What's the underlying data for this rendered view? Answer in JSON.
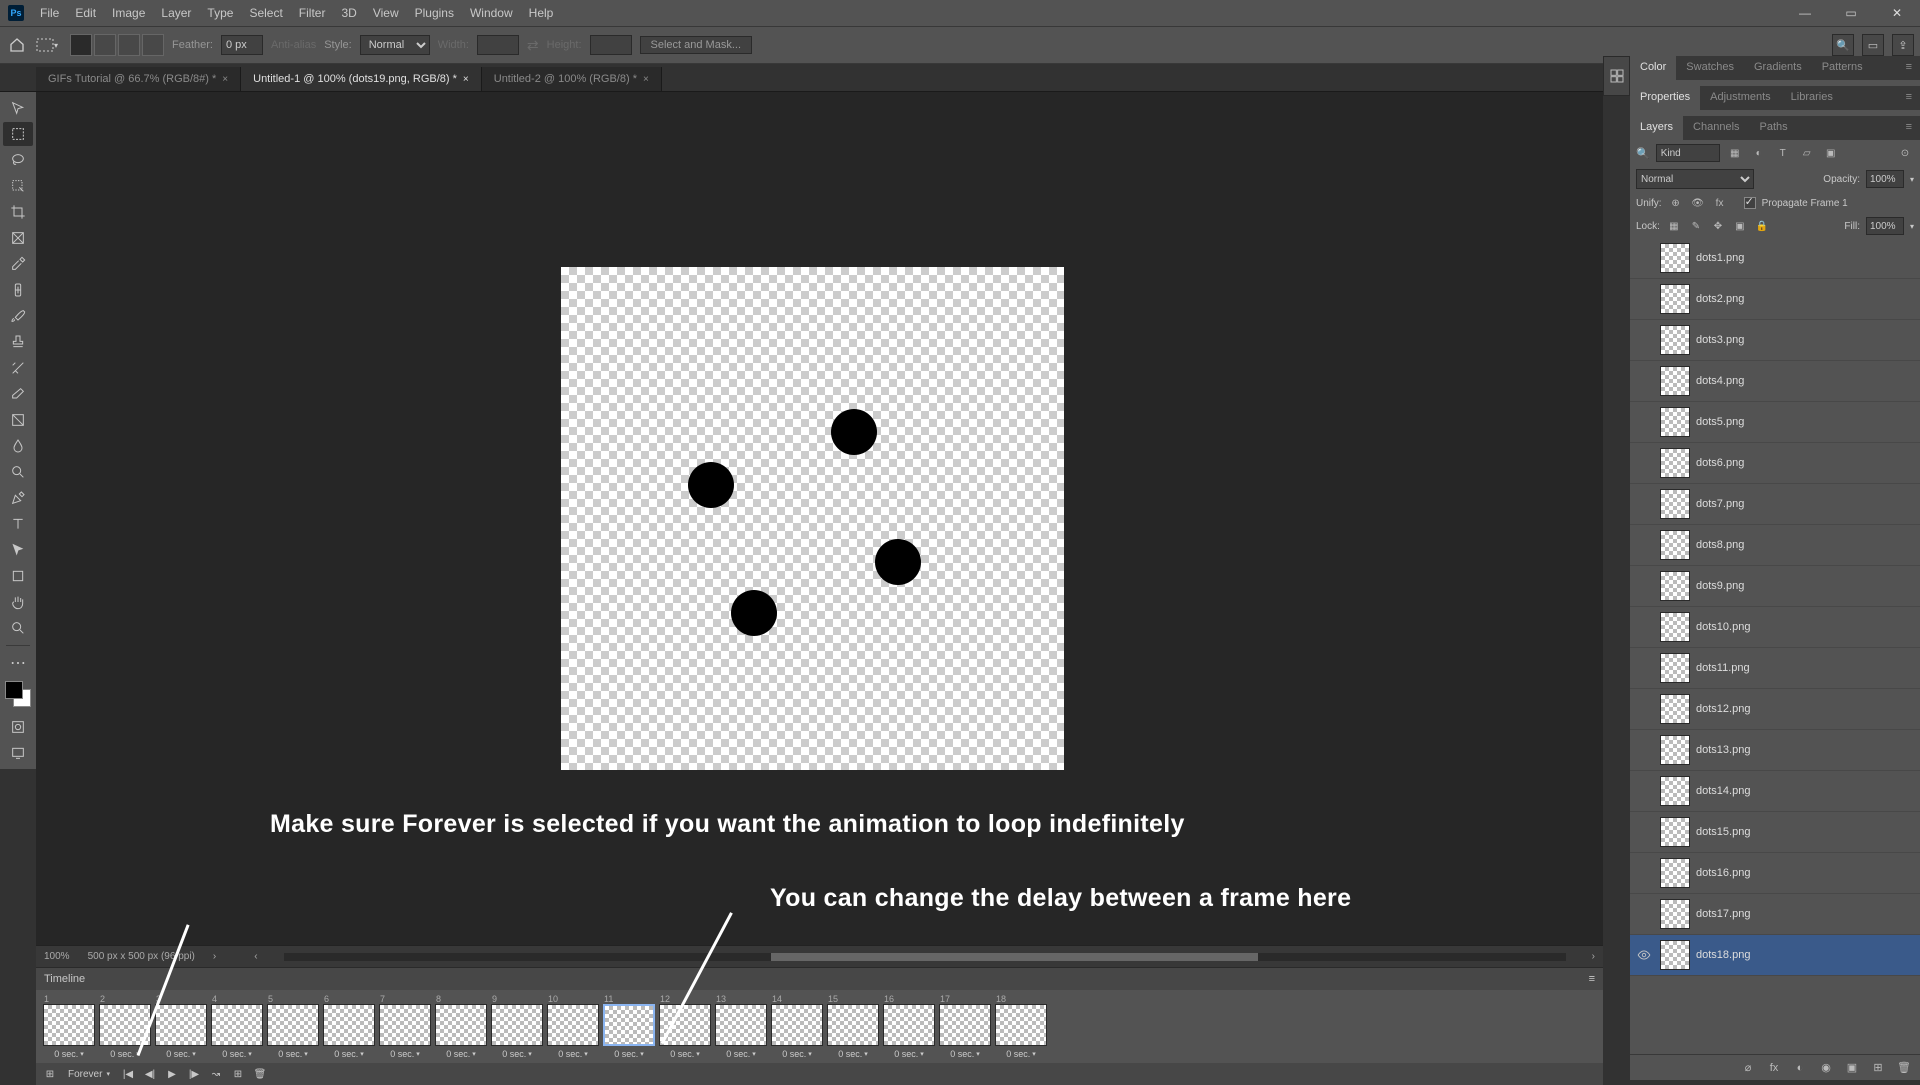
{
  "menu": [
    "File",
    "Edit",
    "Image",
    "Layer",
    "Type",
    "Select",
    "Filter",
    "3D",
    "View",
    "Plugins",
    "Window",
    "Help"
  ],
  "options": {
    "feather_label": "Feather:",
    "feather_value": "0 px",
    "antialias": "Anti-alias",
    "style_label": "Style:",
    "style_value": "Normal",
    "width_label": "Width:",
    "height_label": "Height:",
    "select_mask": "Select and Mask..."
  },
  "tabs": [
    {
      "label": "GIFs Tutorial @ 66.7% (RGB/8#) *",
      "active": false
    },
    {
      "label": "Untitled-1 @ 100% (dots19.png, RGB/8) *",
      "active": true
    },
    {
      "label": "Untitled-2 @ 100% (RGB/8) *",
      "active": false
    }
  ],
  "right_tabs_top": [
    "Color",
    "Swatches",
    "Gradients",
    "Patterns"
  ],
  "right_tabs_mid": [
    "Properties",
    "Adjustments",
    "Libraries"
  ],
  "right_tabs_bot": [
    "Layers",
    "Channels",
    "Paths"
  ],
  "layers_head": {
    "kind": "Kind"
  },
  "blend": {
    "mode": "Normal",
    "opacity_label": "Opacity:",
    "opacity": "100%",
    "fill_label": "Fill:",
    "fill": "100%"
  },
  "unify": {
    "label": "Unify:",
    "prop": "Propagate Frame 1"
  },
  "lock_label": "Lock:",
  "layers": [
    {
      "name": "dots1.png",
      "vis": false
    },
    {
      "name": "dots2.png",
      "vis": false
    },
    {
      "name": "dots3.png",
      "vis": false
    },
    {
      "name": "dots4.png",
      "vis": false
    },
    {
      "name": "dots5.png",
      "vis": false
    },
    {
      "name": "dots6.png",
      "vis": false
    },
    {
      "name": "dots7.png",
      "vis": false
    },
    {
      "name": "dots8.png",
      "vis": false
    },
    {
      "name": "dots9.png",
      "vis": false
    },
    {
      "name": "dots10.png",
      "vis": false
    },
    {
      "name": "dots11.png",
      "vis": false
    },
    {
      "name": "dots12.png",
      "vis": false
    },
    {
      "name": "dots13.png",
      "vis": false
    },
    {
      "name": "dots14.png",
      "vis": false
    },
    {
      "name": "dots15.png",
      "vis": false
    },
    {
      "name": "dots16.png",
      "vis": false
    },
    {
      "name": "dots17.png",
      "vis": false
    },
    {
      "name": "dots18.png",
      "vis": true,
      "sel": true
    }
  ],
  "status": {
    "zoom": "100%",
    "dims": "500 px x 500 px (96 ppi)"
  },
  "timeline": {
    "title": "Timeline",
    "frames": [
      1,
      2,
      3,
      4,
      5,
      6,
      7,
      8,
      9,
      10,
      11,
      12,
      13,
      14,
      15,
      16,
      17,
      18
    ],
    "selected": 11,
    "delay": "0 sec.",
    "loop": "Forever"
  },
  "annotations": {
    "a1": "Make sure Forever is selected if you want the animation to loop indefinitely",
    "a2": "You can change the delay between a frame here"
  }
}
